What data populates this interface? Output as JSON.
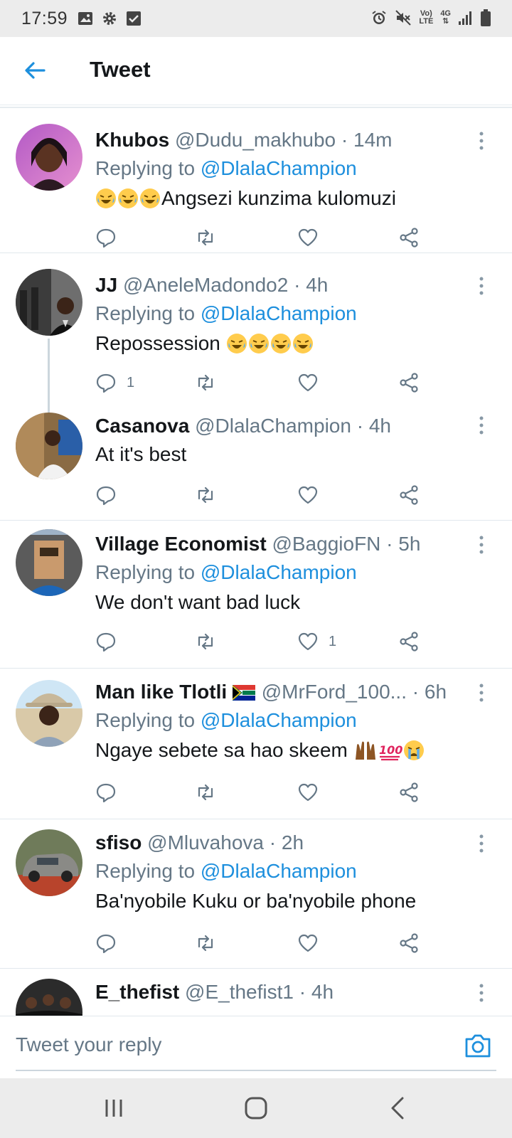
{
  "status": {
    "time": "17:59",
    "net_top": "Vo)",
    "net_bottom": "LTE",
    "gen": "4G"
  },
  "header": {
    "title": "Tweet"
  },
  "tweets": [
    {
      "name": "Khubos",
      "handle": "@Dudu_makhubo",
      "time": "· 14m",
      "replying_label": "Replying to",
      "mention": "@DlalaChampion",
      "text": "Angsezi kunzima kulomuzi",
      "reply_count": "",
      "like_count": ""
    },
    {
      "name": "JJ",
      "handle": "@AneleMadondo2",
      "time": "· 4h",
      "replying_label": "Replying to",
      "mention": "@DlalaChampion",
      "text": "Repossession",
      "reply_count": "1",
      "like_count": ""
    },
    {
      "name": "Casanova",
      "handle": "@DlalaChampion",
      "time": "· 4h",
      "text": "At it's best",
      "reply_count": "",
      "like_count": ""
    },
    {
      "name": "Village Economist",
      "handle": "@BaggioFN",
      "time": "· 5h",
      "replying_label": "Replying to",
      "mention": "@DlalaChampion",
      "text": "We don't want bad luck",
      "reply_count": "",
      "like_count": "1"
    },
    {
      "name": "Man like Tlotli",
      "handle": "@MrFord_100...",
      "time": "· 6h",
      "replying_label": "Replying to",
      "mention": "@DlalaChampion",
      "text": "Ngaye sebete sa hao skeem",
      "reply_count": "",
      "like_count": ""
    },
    {
      "name": "sfiso",
      "handle": "@Mluvahova",
      "time": "· 2h",
      "replying_label": "Replying to",
      "mention": "@DlalaChampion",
      "text": "Ba'nyobile Kuku or ba'nyobile phone",
      "reply_count": "",
      "like_count": ""
    },
    {
      "name": "E_thefist",
      "handle": "@E_thefist1",
      "time": "· 4h"
    }
  ],
  "composer": {
    "placeholder": "Tweet your reply"
  },
  "icons": {
    "back": "arrow-left-icon",
    "reply": "comment-icon",
    "retweet": "retweet-icon",
    "like": "heart-icon",
    "share": "share-icon",
    "more": "kebab-menu-icon",
    "camera": "camera-icon",
    "nav_recents": "recent-apps-icon",
    "nav_home": "home-icon",
    "nav_back": "back-chevron-icon"
  },
  "colors": {
    "accent": "#1d8fdd",
    "secondary_text": "#657786",
    "primary_text": "#14171a",
    "divider": "#e1e8ed"
  }
}
